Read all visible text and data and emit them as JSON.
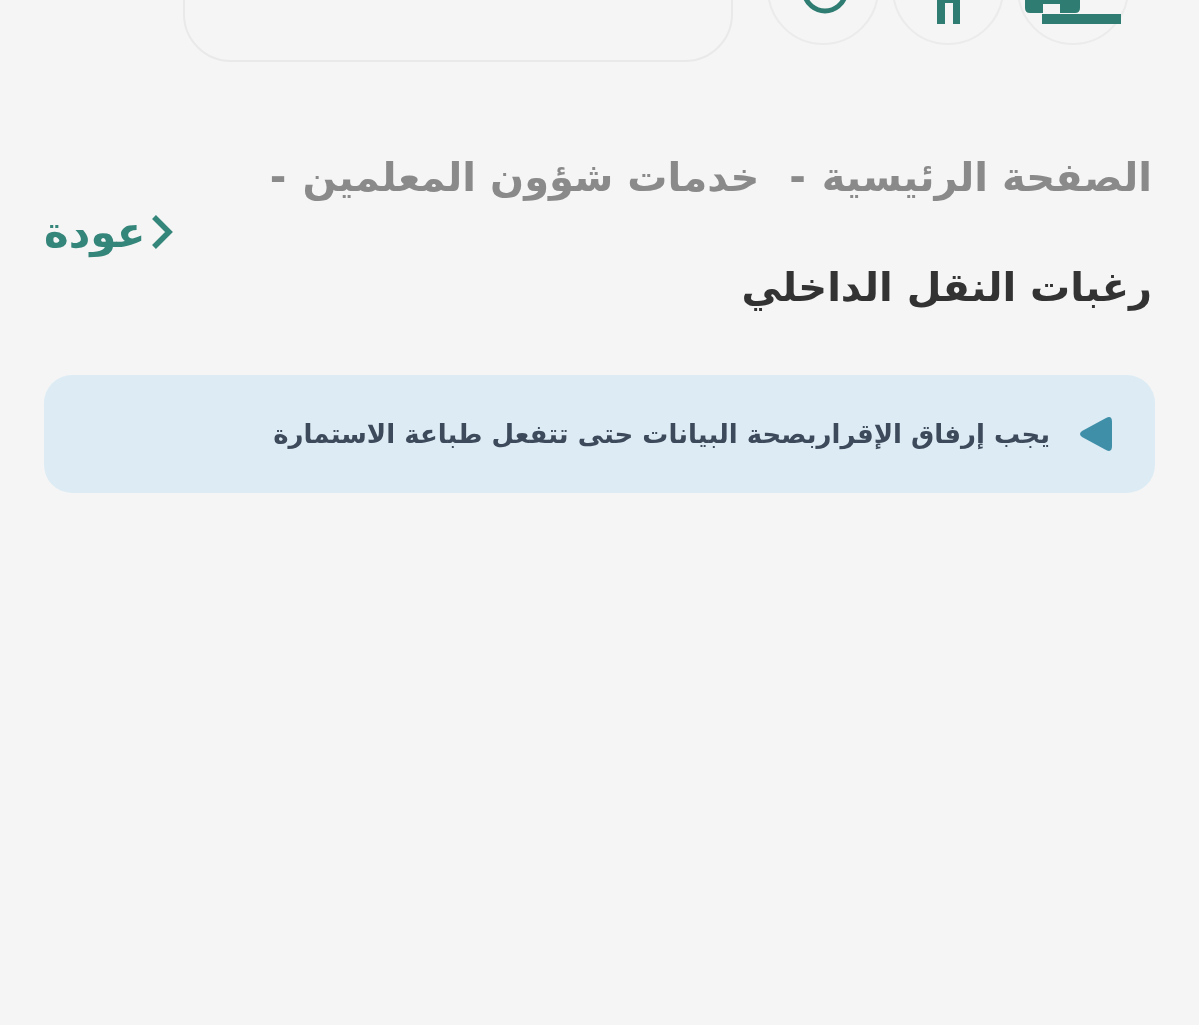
{
  "breadcrumb": {
    "items": [
      {
        "label": "الصفحة الرئيسية",
        "current": false
      },
      {
        "label": "خدمات شؤون المعلمين",
        "current": false
      },
      {
        "label": "رغبات النقل الداخلي",
        "current": true
      }
    ],
    "separators": [
      "-",
      "-"
    ]
  },
  "back_link": {
    "label": "عودة"
  },
  "alert": {
    "message": "يجب إرفاق الإقراربصحة البيانات حتى تتفعل طباعة الاستمارة"
  }
}
